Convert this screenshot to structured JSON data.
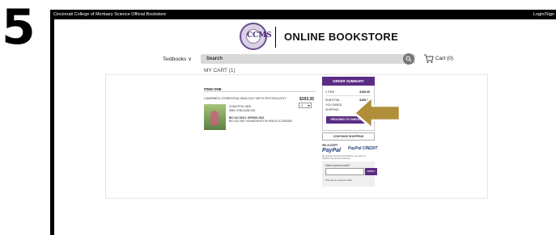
{
  "step_number": "5",
  "topbar": {
    "site_title": "Cincinnati College of Mortuary Science Official Bookstore",
    "login_label": "Login/Sign"
  },
  "header": {
    "logo_monogram": "CCMS",
    "store_name": "ONLINE BOOKSTORE"
  },
  "nav": {
    "textbooks_label": "Textbooks ∨",
    "search_placeholder": "Search",
    "cart_label": "Cart (0)"
  },
  "cart": {
    "heading": "MY CART (1)",
    "section_label": "ITEM ONE",
    "item": {
      "title": "CAMPBELL ESSENTIAL BIOLOGY WITH PHYSIOLOGY",
      "price": "$193.35",
      "quantity": "1",
      "condition": "CONDITION: NEW",
      "isbn": "ISBN: 9780134357025",
      "course": "BIO 104 ONLY: SPRING 2022",
      "course_desc": "BIO 104 ONLY HUMAN BODY IN HEALTH & DISEASE"
    }
  },
  "summary": {
    "title": "ORDER SUMMARY",
    "rows": [
      {
        "label": "1 ITEM",
        "value": "$189.95"
      },
      {
        "label": "SUBTOTAL",
        "value": "$189.95"
      },
      {
        "label": "YOU SAVED",
        "value": "-"
      },
      {
        "label": "SHIPPING",
        "value": "FREE"
      }
    ],
    "checkout_label": "PROCEED TO CHECKOUT",
    "continue_label": "CONTINUE SHOPPING",
    "we_accept": "WE ACCEPT",
    "paypal": "PayPal",
    "paypal_credit": "PayPal CREDIT",
    "fine_note": "By clicking Checkout with PayPal, you agree to PayPal's terms and conditions.",
    "promo_label": "Have a promo code?",
    "apply_label": "APPLY",
    "promo_note": "One promo code per order"
  },
  "colors": {
    "brand_purple": "#5b2c84",
    "arrow": "#b08e3a"
  }
}
